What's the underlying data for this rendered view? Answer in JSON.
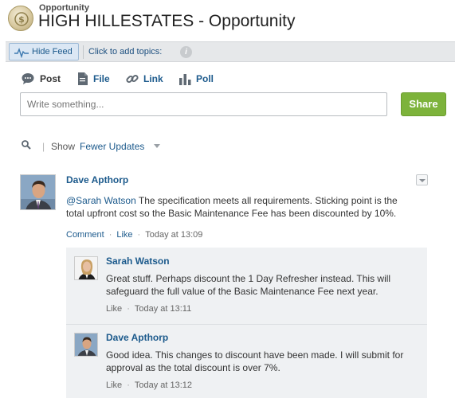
{
  "header": {
    "object_type": "Opportunity",
    "title": "HIGH HILLESTATES - Opportunity"
  },
  "toolbar": {
    "hide_feed_label": "Hide Feed",
    "topics_label": "Click to add topics:",
    "info_glyph": "i"
  },
  "publisher": {
    "tabs": [
      {
        "label": "Post",
        "icon": "speech-bubble-icon",
        "active": true
      },
      {
        "label": "File",
        "icon": "file-icon",
        "active": false
      },
      {
        "label": "Link",
        "icon": "link-icon",
        "active": false
      },
      {
        "label": "Poll",
        "icon": "poll-icon",
        "active": false
      }
    ],
    "placeholder": "Write something...",
    "share_label": "Share"
  },
  "filter": {
    "separator": "|",
    "show_label": "Show",
    "value": "Fewer Updates"
  },
  "post": {
    "author": "Dave Apthorp",
    "mention": "@Sarah Watson",
    "body": "The specification meets all requirements. Sticking point is the total upfront cost so the Basic Maintenance Fee has been discounted by 10%.",
    "comment_label": "Comment",
    "like_label": "Like",
    "timestamp": "Today at 13:09",
    "separator": "·"
  },
  "comments": [
    {
      "author": "Sarah Watson",
      "body": "Great stuff. Perhaps discount the 1 Day Refresher instead. This will safeguard the full value of the Basic Maintenance Fee next year.",
      "like_label": "Like",
      "timestamp": "Today at 13:11"
    },
    {
      "author": "Dave Apthorp",
      "body": "Good idea. This changes to discount have been made. I will submit for approval as the total discount is over 7%.",
      "like_label": "Like",
      "timestamp": "Today at 13:12"
    }
  ],
  "colors": {
    "link": "#1c5a8c",
    "share_button": "#7db33b",
    "toolbar_bg": "#e6e8ea",
    "comments_bg": "#eff1f3"
  }
}
